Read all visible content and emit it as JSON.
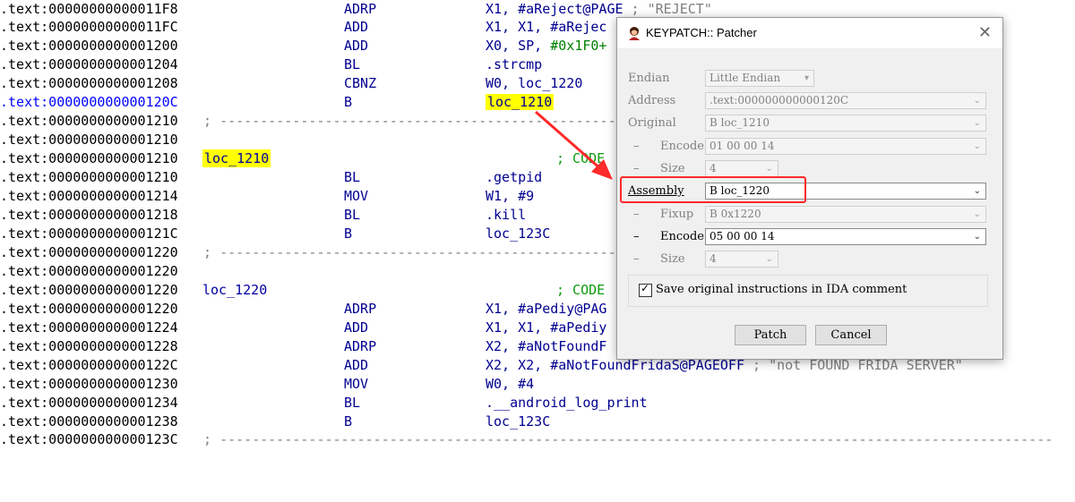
{
  "listing": [
    {
      "addr": ".text:00000000000011F8",
      "mnemonic": "ADRP",
      "operand": "X1, #aReject@PAGE",
      "comment": " ; \"REJECT\""
    },
    {
      "addr": ".text:00000000000011FC",
      "mnemonic": "ADD",
      "operand": "X1, X1, #aRejec"
    },
    {
      "addr": ".text:0000000000001200",
      "mnemonic": "ADD",
      "operand_pre": "X0, SP, ",
      "operand_num": "#0x1F0+"
    },
    {
      "addr": ".text:0000000000001204",
      "mnemonic": "BL",
      "operand": ".strcmp"
    },
    {
      "addr": ".text:0000000000001208",
      "mnemonic": "CBNZ",
      "operand": "W0, loc_1220"
    },
    {
      "addr": ".text:000000000000120C",
      "mnemonic": "B",
      "operand_hl": "loc_1210",
      "selected": true
    },
    {
      "addr": ".text:0000000000001210",
      "sep": " ; --------------------------------------------------"
    },
    {
      "addr": ".text:0000000000001210"
    },
    {
      "addr": ".text:0000000000001210",
      "label_hl": "loc_1210",
      "code_comment": "; CODE"
    },
    {
      "addr": ".text:0000000000001210",
      "mnemonic": "BL",
      "operand": ".getpid"
    },
    {
      "addr": ".text:0000000000001214",
      "mnemonic": "MOV",
      "operand": "W1, #9"
    },
    {
      "addr": ".text:0000000000001218",
      "mnemonic": "BL",
      "operand": ".kill"
    },
    {
      "addr": ".text:000000000000121C",
      "mnemonic": "B",
      "operand": "loc_123C"
    },
    {
      "addr": ".text:0000000000001220",
      "sep": " ; --------------------------------------------------"
    },
    {
      "addr": ".text:0000000000001220"
    },
    {
      "addr": ".text:0000000000001220",
      "label": "loc_1220",
      "code_comment": "; CODE"
    },
    {
      "addr": ".text:0000000000001220",
      "mnemonic": "ADRP",
      "operand": "X1, #aPediy@PAG"
    },
    {
      "addr": ".text:0000000000001224",
      "mnemonic": "ADD",
      "operand": "X1, X1, #aPediy"
    },
    {
      "addr": ".text:0000000000001228",
      "mnemonic": "ADRP",
      "operand": "X2, #aNotFoundF"
    },
    {
      "addr": ".text:000000000000122C",
      "mnemonic": "ADD",
      "operand": "X2, X2, #aNotFoundFridaS@PAGEOFF",
      "comment": " ; \"not FOUND FRIDA SERVER\""
    },
    {
      "addr": ".text:0000000000001230",
      "mnemonic": "MOV",
      "operand": "W0, #4"
    },
    {
      "addr": ".text:0000000000001234",
      "mnemonic": "BL",
      "operand": ".__android_log_print"
    },
    {
      "addr": ".text:0000000000001238",
      "mnemonic": "B",
      "operand": "loc_123C"
    },
    {
      "addr": ".text:000000000000123C",
      "sep": " ; -------------------------------------------------------------------------------------------------------"
    }
  ],
  "dialog": {
    "title": "KEYPATCH:: Patcher",
    "close_glyph": "✕",
    "endian_label": "Endian",
    "endian_value": "Little Endian",
    "address_label": "Address",
    "address_value": ".text:000000000000120C",
    "original_label": "Original",
    "original_value": "B loc_1210",
    "dash": "–",
    "encode_label": "Encode",
    "original_encode": "01 00 00 14",
    "size_label": "Size",
    "original_size": "4",
    "assembly_label": "Assembly",
    "assembly_value": "B loc_1220",
    "fixup_label": "Fixup",
    "fixup_value": "B 0x1220",
    "new_encode": "05 00 00 14",
    "new_size": "4",
    "save_checkbox_label": "Save original instructions in IDA comment",
    "save_checked": true,
    "patch_button": "Patch",
    "cancel_button": "Cancel"
  },
  "colors": {
    "annotation": "#ff2a2a",
    "highlight": "#ffff00",
    "address_selected": "#0000ff"
  }
}
